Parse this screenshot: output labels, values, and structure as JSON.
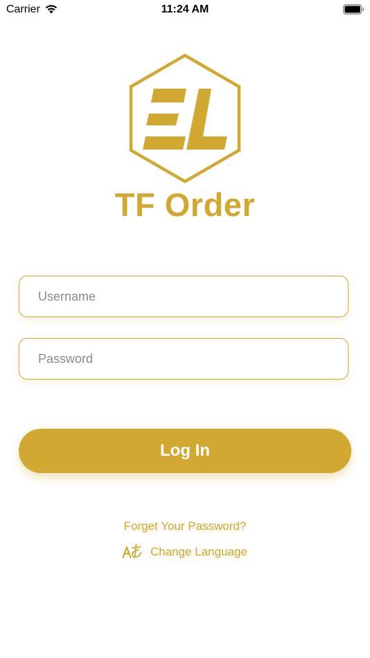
{
  "status_bar": {
    "carrier": "Carrier",
    "time": "11:24 AM",
    "wifi_icon": "wifi-icon",
    "battery_icon": "battery-full-icon"
  },
  "branding": {
    "logo_icon": "el-hexagon-logo",
    "app_name": "TF Order"
  },
  "form": {
    "username_placeholder": "Username",
    "username_value": "",
    "password_placeholder": "Password",
    "password_value": "",
    "login_label": "Log In"
  },
  "links": {
    "forgot_password": "Forget Your Password?",
    "change_language": "Change Language",
    "language_icon": "translate-icon"
  },
  "colors": {
    "accent": "#d1a832",
    "background": "#ffffff",
    "placeholder": "#8a8a8a"
  }
}
